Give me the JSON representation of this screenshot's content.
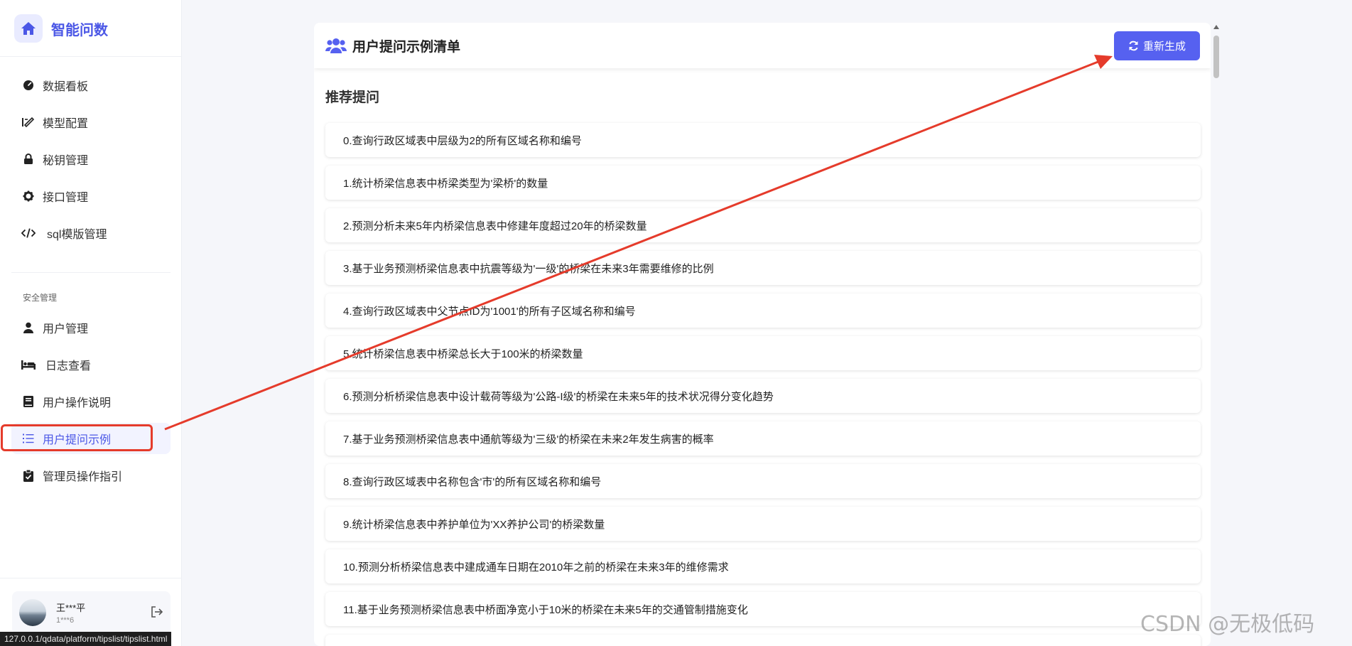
{
  "brand": {
    "title": "智能问数"
  },
  "nav_top": [
    {
      "label": "数据看板",
      "icon": "gauge-icon"
    },
    {
      "label": "模型配置",
      "icon": "brush-icon"
    },
    {
      "label": "秘钥管理",
      "icon": "lock-icon"
    },
    {
      "label": "接口管理",
      "icon": "gear-icon"
    },
    {
      "label": "sql模版管理",
      "icon": "code-icon"
    }
  ],
  "nav_group_label": "安全管理",
  "nav_security": [
    {
      "label": "用户管理",
      "icon": "user-icon"
    },
    {
      "label": "日志查看",
      "icon": "bed-icon"
    },
    {
      "label": "用户操作说明",
      "icon": "book-icon"
    },
    {
      "label": "用户提问示例",
      "icon": "list-icon",
      "active": true
    },
    {
      "label": "管理员操作指引",
      "icon": "clipboard-icon"
    }
  ],
  "user": {
    "name": "王***平",
    "phone": "1***6"
  },
  "status_url": "127.0.0.1/qdata/platform/tipslist/tipslist.html",
  "header": {
    "title": "用户提问示例清单",
    "regen_label": "重新生成"
  },
  "section_title": "推荐提问",
  "tips": [
    "0.查询行政区域表中层级为2的所有区域名称和编号",
    "1.统计桥梁信息表中桥梁类型为'梁桥'的数量",
    "2.预测分析未来5年内桥梁信息表中修建年度超过20年的桥梁数量",
    "3.基于业务预测桥梁信息表中抗震等级为'一级'的桥梁在未来3年需要维修的比例",
    "4.查询行政区域表中父节点ID为'1001'的所有子区域名称和编号",
    "5.统计桥梁信息表中桥梁总长大于100米的桥梁数量",
    "6.预测分析桥梁信息表中设计载荷等级为'公路-I级'的桥梁在未来5年的技术状况得分变化趋势",
    "7.基于业务预测桥梁信息表中通航等级为'三级'的桥梁在未来2年发生病害的概率",
    "8.查询行政区域表中名称包含'市'的所有区域名称和编号",
    "9.统计桥梁信息表中养护单位为'XX养护公司'的桥梁数量",
    "10.预测分析桥梁信息表中建成通车日期在2010年之前的桥梁在未来3年的维修需求",
    "11.基于业务预测桥梁信息表中桥面净宽小于10米的桥梁在未来5年的交通管制措施变化"
  ],
  "watermark": "CSDN @无极低码",
  "colors": {
    "accent": "#5661f0",
    "brand": "#4b57e6",
    "annotation": "#e53b2b"
  }
}
